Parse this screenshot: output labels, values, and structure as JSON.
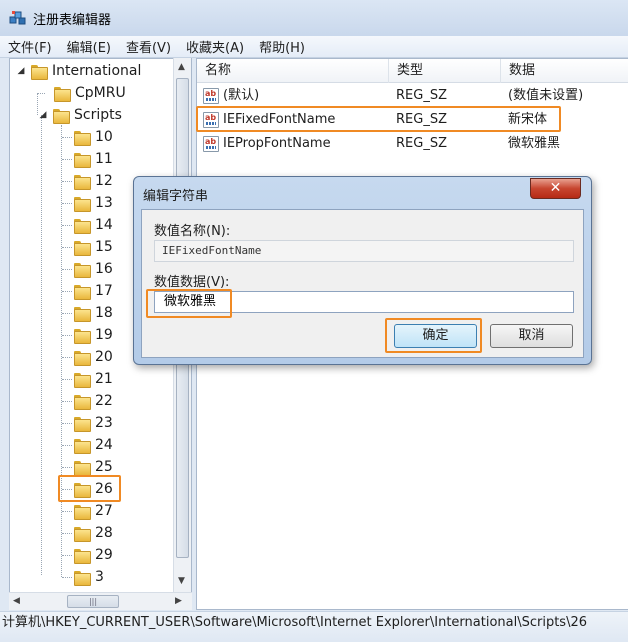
{
  "window": {
    "title": "注册表编辑器"
  },
  "menu": [
    "文件(F)",
    "编辑(E)",
    "查看(V)",
    "收藏夹(A)",
    "帮助(H)"
  ],
  "tree": {
    "international": "International",
    "cpmru": "CpMRU",
    "scripts": "Scripts",
    "script_keys": [
      "10",
      "11",
      "12",
      "13",
      "14",
      "15",
      "16",
      "17",
      "18",
      "19",
      "20",
      "21",
      "22",
      "23",
      "24",
      "25",
      "26",
      "27",
      "28",
      "29",
      "3"
    ],
    "selected": "26"
  },
  "list": {
    "columns": {
      "name": "名称",
      "type": "类型",
      "data": "数据"
    },
    "rows": [
      {
        "name": "(默认)",
        "type": "REG_SZ",
        "data": "(数值未设置)"
      },
      {
        "name": "IEFixedFontName",
        "type": "REG_SZ",
        "data": "新宋体"
      },
      {
        "name": "IEPropFontName",
        "type": "REG_SZ",
        "data": "微软雅黑"
      }
    ]
  },
  "dialog": {
    "title": "编辑字符串",
    "close_label": "✕",
    "name_label": "数值名称(N):",
    "name_value": "IEFixedFontName",
    "data_label": "数值数据(V):",
    "data_value": "微软雅黑",
    "ok_label": "确定",
    "cancel_label": "取消"
  },
  "status_bar": {
    "path": "计算机\\HKEY_CURRENT_USER\\Software\\Microsoft\\Internet Explorer\\International\\Scripts\\26"
  },
  "colors": {
    "highlight": "#f08a24",
    "window_frame": "#dfe8f3"
  },
  "icons": {
    "app": "regedit-icon",
    "folder": "folder-icon",
    "string_value": "string-value-icon"
  }
}
